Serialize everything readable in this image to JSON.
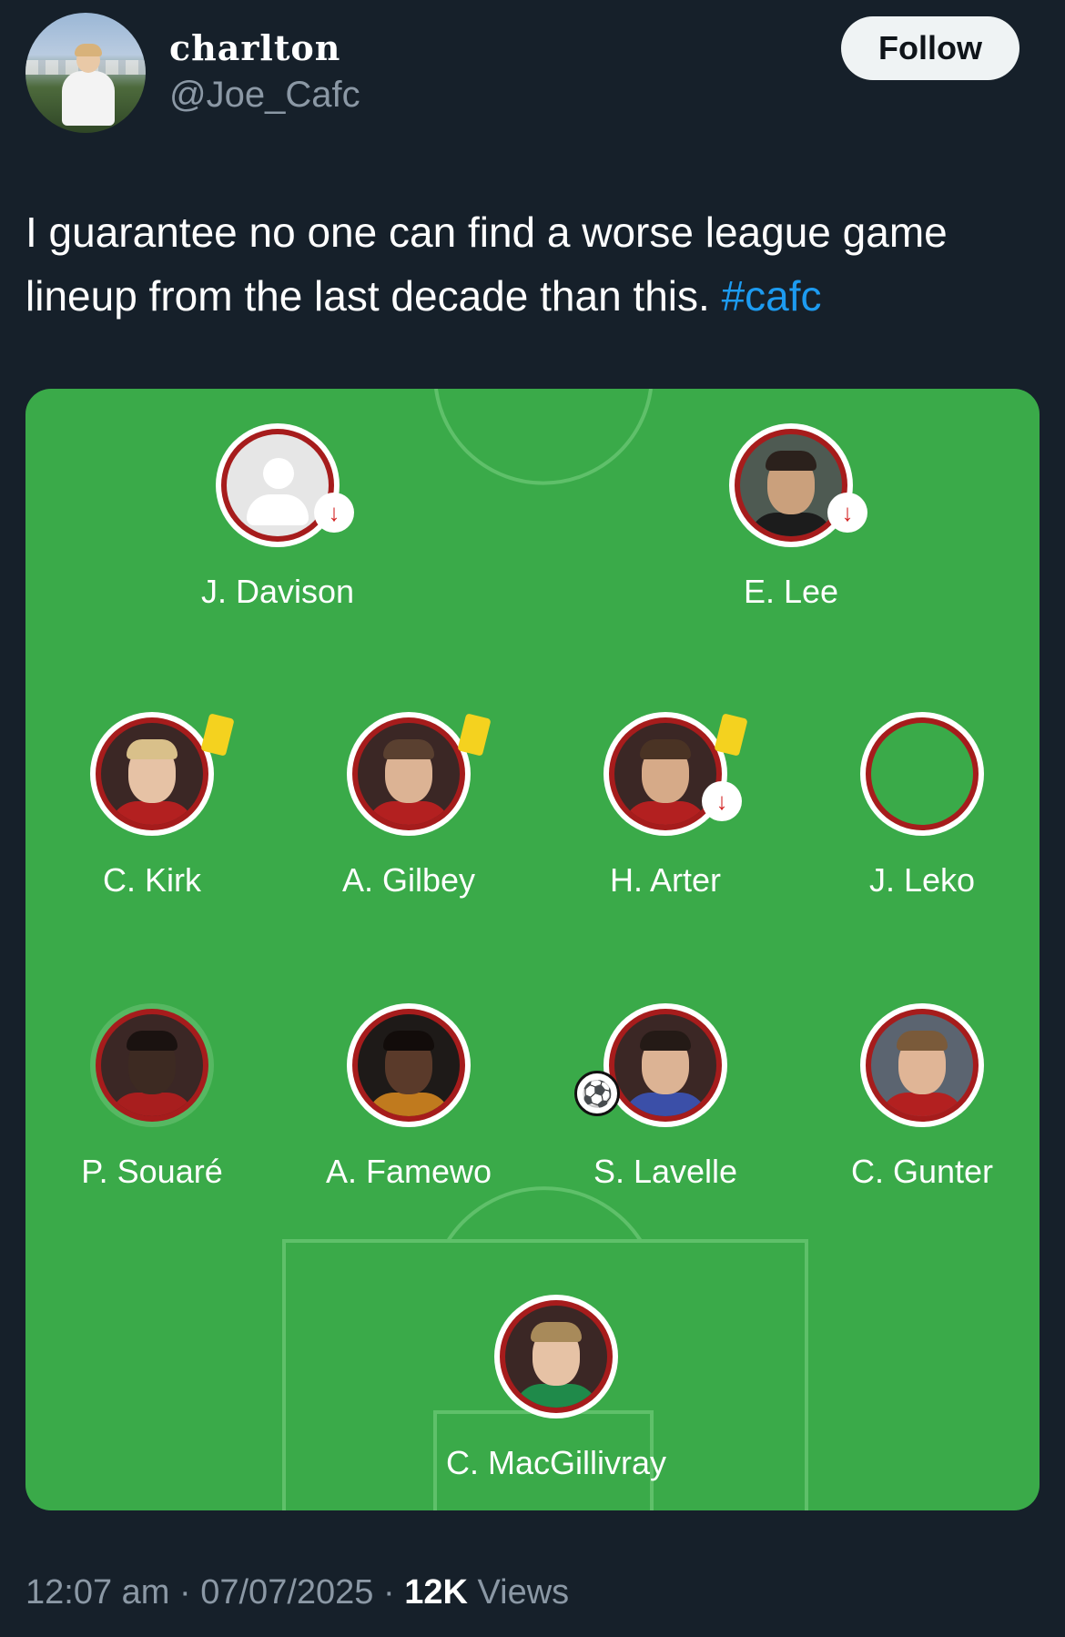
{
  "author": {
    "display_name": "charlton",
    "handle": "@Joe_Cafc",
    "avatar_icon": "profile-photo"
  },
  "follow_label": "Follow",
  "tweet": {
    "text": "I guarantee no one can find a worse league game lineup from the last decade than this. ",
    "hashtag": "#cafc"
  },
  "colors": {
    "pitch": "#3aaa49",
    "ring": "#a61c1c",
    "accent": "#1d9bf0",
    "yellow_card": "#f4d21f",
    "sub_arrow": "#d32424"
  },
  "lineup": {
    "players": [
      {
        "name": "J. Davison",
        "photo": "placeholder-person-icon",
        "subbed_off": true
      },
      {
        "name": "E. Lee",
        "photo": "player-photo",
        "subbed_off": true
      },
      {
        "name": "C. Kirk",
        "photo": "player-photo",
        "yellow_card": true
      },
      {
        "name": "A. Gilbey",
        "photo": "player-photo",
        "yellow_card": true
      },
      {
        "name": "H. Arter",
        "photo": "player-photo",
        "yellow_card": true,
        "subbed_off": true
      },
      {
        "name": "J. Leko",
        "photo": "empty"
      },
      {
        "name": "P. Souaré",
        "photo": "player-photo"
      },
      {
        "name": "A. Famewo",
        "photo": "player-photo"
      },
      {
        "name": "S. Lavelle",
        "photo": "player-photo",
        "goal": true
      },
      {
        "name": "C. Gunter",
        "photo": "player-photo"
      },
      {
        "name": "C. MacGillivray",
        "photo": "player-photo"
      }
    ],
    "icons": {
      "sub_arrow": "↓",
      "goal": "⚽"
    }
  },
  "meta": {
    "time": "12:07 am",
    "sep": " · ",
    "date": "07/07/2025",
    "views_count": "12K",
    "views_label": " Views"
  }
}
